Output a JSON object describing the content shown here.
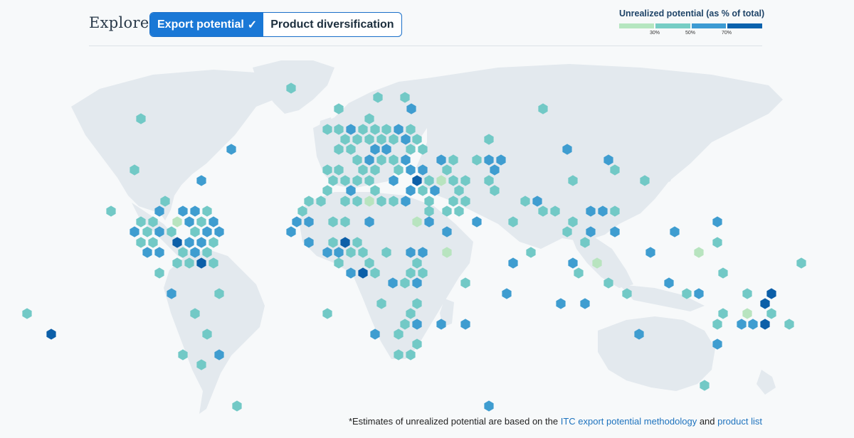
{
  "header": {
    "title": "Explore",
    "tabs": [
      {
        "label": "Export potential",
        "active": true,
        "icon": "check-icon"
      },
      {
        "label": "Product diversification",
        "active": false
      }
    ]
  },
  "legend": {
    "title": "Unrealized potential (as % of total)",
    "ticks": [
      "30%",
      "50%",
      "70%"
    ],
    "colors": [
      "#b5e6c0",
      "#77cdc5",
      "#3d9bd3",
      "#0a62ad"
    ]
  },
  "colors": {
    "land": "#e3e9ee",
    "accent": "#1a78d6",
    "link": "#1e73be",
    "levels": [
      "#b8e4bf",
      "#72c9c6",
      "#3f9dd0",
      "#0c5fa8"
    ]
  },
  "footnote": {
    "prefix": "*Estimates of unrealized potential are based on the ",
    "link1": "ITC export potential methodology",
    "middle": " and ",
    "link2": "product list"
  }
}
